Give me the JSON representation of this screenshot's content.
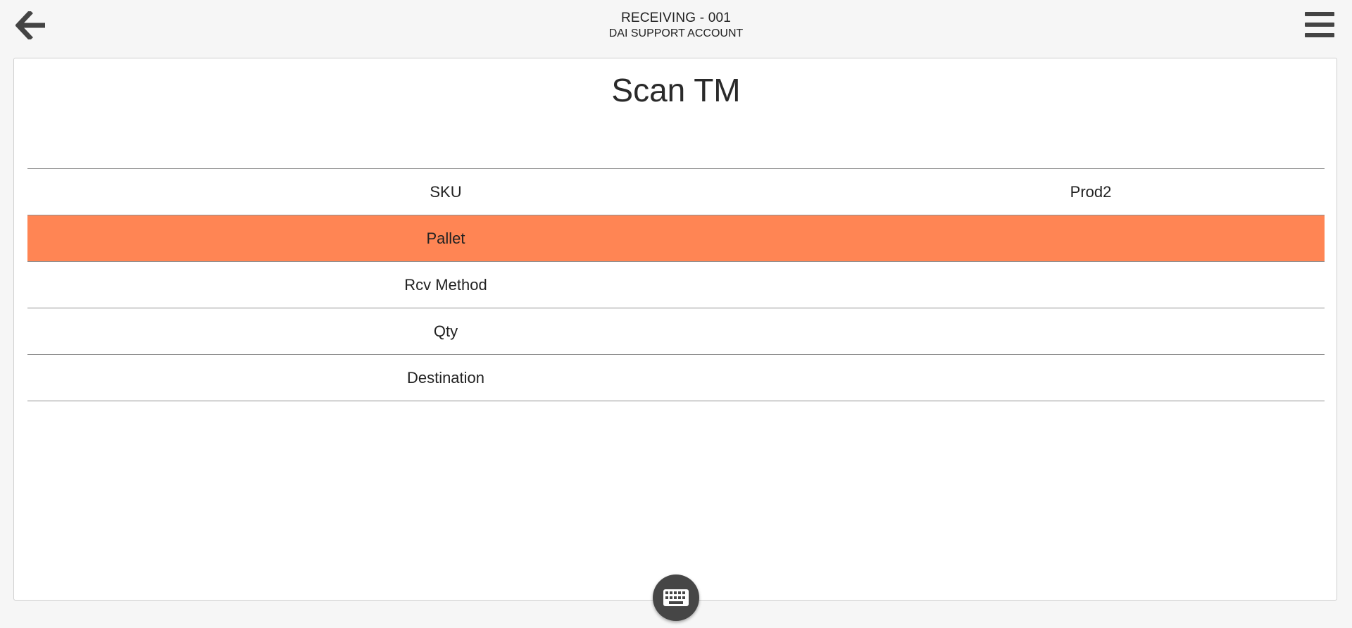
{
  "header": {
    "title": "RECEIVING - 001",
    "subtitle": "DAI SUPPORT ACCOUNT",
    "back_icon": "arrow-left-icon",
    "menu_icon": "hamburger-menu-icon"
  },
  "main": {
    "page_title": "Scan TM",
    "rows": [
      {
        "label": "SKU",
        "value": "Prod2",
        "active": false
      },
      {
        "label": "Pallet",
        "value": "",
        "active": true
      },
      {
        "label": "Rcv Method",
        "value": "",
        "active": false
      },
      {
        "label": "Qty",
        "value": "",
        "active": false
      },
      {
        "label": "Destination",
        "value": "",
        "active": false
      }
    ]
  },
  "footer": {
    "keyboard_icon": "keyboard-icon"
  },
  "colors": {
    "active_row": "#ff8554",
    "background": "#f6f6f6",
    "panel": "#ffffff",
    "fab": "#464646"
  }
}
